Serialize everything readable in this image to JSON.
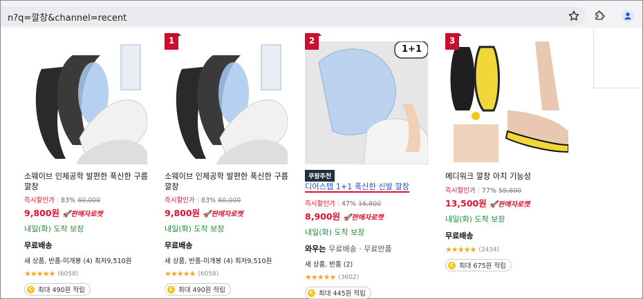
{
  "browser": {
    "url": "n?q=깔창&channel=recent"
  },
  "products": [
    {
      "rank": "",
      "coupang_badge": "",
      "title": "소웨이브 인체공학 발편한 푹신한 구름 깔창",
      "discount_label": "즉시할인가",
      "discount_rate": "83%",
      "original_price": "60,000",
      "price": "9,800원",
      "rocket_label": "판매자로켓",
      "delivery": "내일(화) 도착 보장",
      "shipping": "무료배송",
      "shipping_extra": "",
      "options": "새 상품, 반품-미개봉 (4) 최저9,510원",
      "review_count": "(6058)",
      "stars": "★★★★★",
      "reward": "최대 490원 적립"
    },
    {
      "rank": "1",
      "coupang_badge": "",
      "title": "소웨이브 인체공학 발편한 푹신한 구름 깔창",
      "discount_label": "즉시할인가",
      "discount_rate": "83%",
      "original_price": "60,000",
      "price": "9,800원",
      "rocket_label": "판매자로켓",
      "delivery": "내일(화) 도착 보장",
      "shipping": "무료배송",
      "shipping_extra": "",
      "options": "새 상품, 반품-미개봉 (4) 최저9,510원",
      "review_count": "(6058)",
      "stars": "★★★★★",
      "reward": "최대 490원 적립"
    },
    {
      "rank": "2",
      "coupang_badge": "쿠팡추천",
      "title": "디어스텝 1+1 푹신한 신발 깔창",
      "discount_label": "즉시할인가",
      "discount_rate": "47%",
      "original_price": "16,800",
      "price": "8,900원",
      "rocket_label": "판매자로켓",
      "delivery": "내일(화) 도착 보장",
      "shipping": "와우는",
      "shipping_extra": "무료배송 · 무료반품",
      "options": "새 상품, 반품 (2)",
      "review_count": "(3602)",
      "stars": "★★★★★",
      "reward": "최대 445원 적립",
      "image_badge": "1+1"
    },
    {
      "rank": "3",
      "coupang_badge": "",
      "title": "메디워크 깔창 아치 기능성",
      "discount_label": "즉시할인가",
      "discount_rate": "77%",
      "original_price": "59,800",
      "price": "13,500원",
      "rocket_label": "판매자로켓",
      "delivery": "내일(화) 도착 보장",
      "shipping": "무료배송",
      "shipping_extra": "",
      "options": "",
      "review_count": "(2434)",
      "stars": "★★★★★",
      "reward": "최대 675원 적립"
    }
  ],
  "colors": {
    "price_red": "#e0102b",
    "delivery_green": "#1e8c3a",
    "star_orange": "#f5a623",
    "rank_red": "#c8102e"
  }
}
